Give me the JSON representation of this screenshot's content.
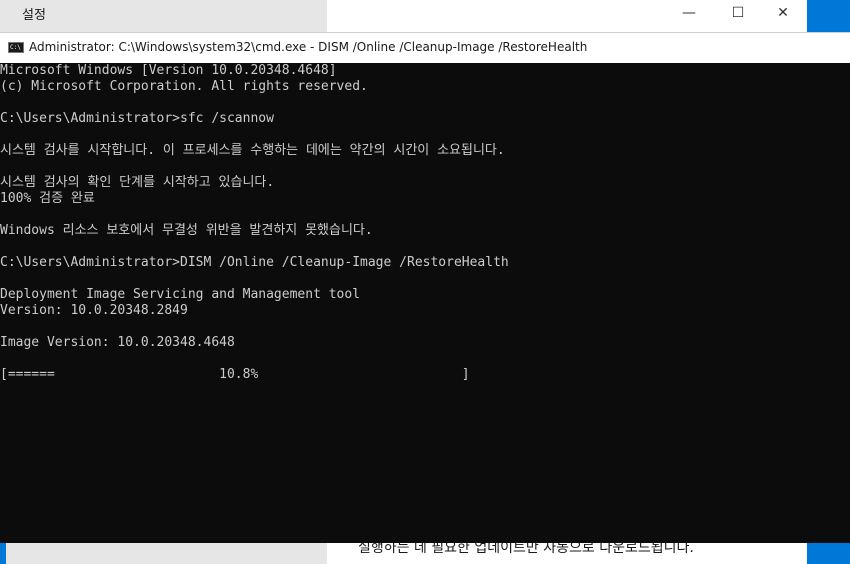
{
  "settings": {
    "title": "설정",
    "controls": {
      "minimize": "—",
      "maximize": "☐",
      "close": "✕"
    },
    "bottom_text": "실행하는 데 필요한 업데이트만 자동으로 다운로드됩니다."
  },
  "cmd": {
    "title": "Administrator: C:\\Windows\\system32\\cmd.exe - DISM  /Online /Cleanup-Image /RestoreHealth",
    "lines": [
      "Microsoft Windows [Version 10.0.20348.4648]",
      "(c) Microsoft Corporation. All rights reserved.",
      "",
      "C:\\Users\\Administrator>sfc /scannow",
      "",
      "시스템 검사를 시작합니다. 이 프로세스를 수행하는 데에는 약간의 시간이 소요됩니다.",
      "",
      "시스템 검사의 확인 단계를 시작하고 있습니다.",
      "100% 검증 완료",
      "",
      "Windows 리소스 보호에서 무결성 위반을 발견하지 못했습니다.",
      "",
      "C:\\Users\\Administrator>DISM /Online /Cleanup-Image /RestoreHealth",
      "",
      "Deployment Image Servicing and Management tool",
      "Version: 10.0.20348.2849",
      "",
      "Image Version: 10.0.20348.4648",
      "",
      "[======                     10.8%                          ]"
    ],
    "progress_percent": 10.8
  }
}
